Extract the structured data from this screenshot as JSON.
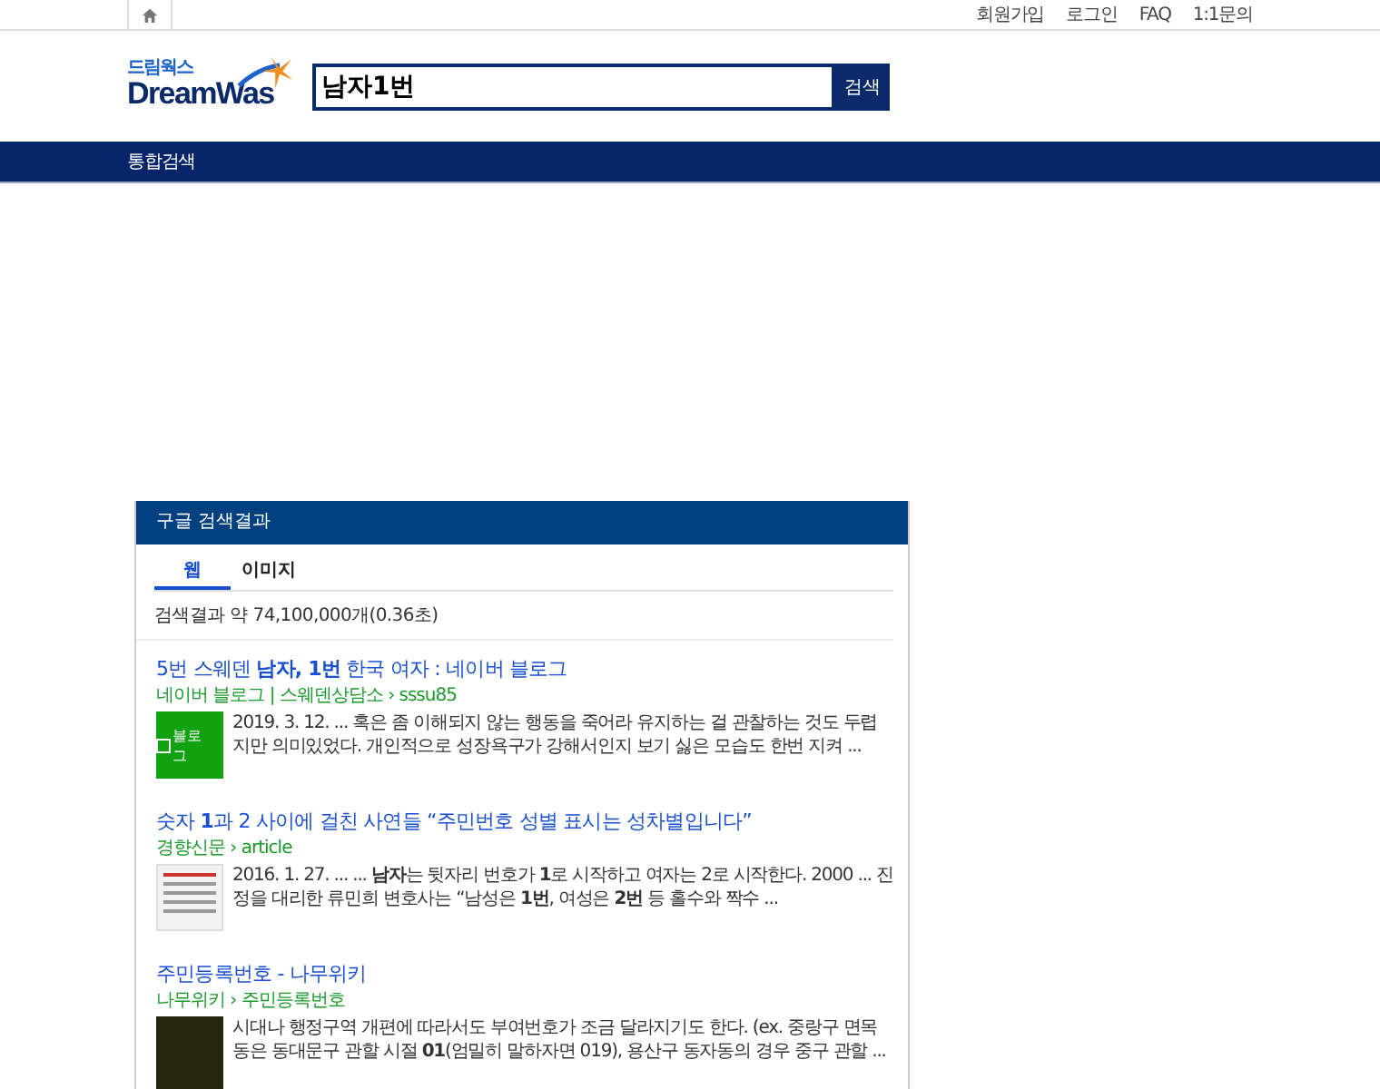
{
  "top_links": [
    "회원가입",
    "로그인",
    "FAQ",
    "1:1문의"
  ],
  "logo": {
    "small": "드림웍스",
    "main": "DreamWas"
  },
  "search": {
    "value": "남자1번",
    "button": "검색"
  },
  "nav": [
    "통합검색"
  ],
  "panel": {
    "title": "구글 검색결과",
    "tabs": [
      {
        "label": "웹",
        "selected": true
      },
      {
        "label": "이미지",
        "selected": false
      }
    ],
    "count": "검색결과 약 74,100,000개(0.36초)",
    "results": [
      {
        "title": "5번 스웨덴 **남자, 1번** 한국 여자 : 네이버 블로그",
        "source": "네이버 블로그 | 스웨덴상담소 › sssu85",
        "thumb": {
          "kind": "blog",
          "label": "블로그"
        },
        "snippet": "2019. 3. 12. ... 혹은 좀 이해되지 않는 행동을 죽어라 유지하는 걸 관찰하는 것도 두렵지만 의미있었다. 개인적으로 성장욕구가 강해서인지 보기 싫은 모습도 한번 지켜 ..."
      },
      {
        "title": "숫자 **1**과 2 사이에 걸친 사연들 “주민번호 성별 표시는 성차별입니다”",
        "source": "경향신문 › article",
        "thumb": {
          "kind": "document"
        },
        "snippet": "2016. 1. 27. ... ... **남자**는 뒷자리 번호가 **1**로 시작하고 여자는 2로 시작한다. 2000 ... 진정을 대리한 류민희 변호사는 “남성은 **1번**, 여성은 **2번** 등 홀수와 짝수 ..."
      },
      {
        "title": "주민등록번호 - 나무위키",
        "source": "나무위키 › 주민등록번호",
        "thumb": {
          "kind": "photo"
        },
        "snippet": "시대나 행정구역 개편에 따라서도 부여번호가 조금 달라지기도 한다. (ex. 중랑구 면목동은 동대문구 관할 시절 **01**(엄밀히 말하자면 019), 용산구 동자동의 경우 중구 관할 ..."
      }
    ]
  }
}
